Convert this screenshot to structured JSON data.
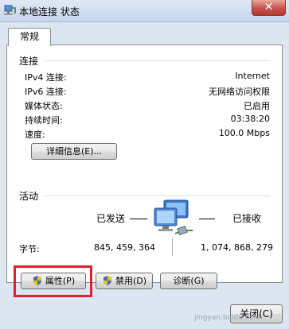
{
  "window": {
    "title": "本地连接 状态",
    "close_glyph": "✕"
  },
  "tabs": [
    {
      "label": "常规"
    }
  ],
  "connection": {
    "heading": "连接",
    "rows": [
      {
        "label": "IPv4 连接:",
        "value": "Internet"
      },
      {
        "label": "IPv6 连接:",
        "value": "无网络访问权限"
      },
      {
        "label": "媒体状态:",
        "value": "已启用"
      },
      {
        "label": "持续时间:",
        "value": "03:38:20"
      },
      {
        "label": "速度:",
        "value": "100.0 Mbps"
      }
    ],
    "details_button": "详细信息(E)..."
  },
  "activity": {
    "heading": "活动",
    "sent_label": "已发送",
    "received_label": "已接收",
    "bytes_label": "字节:",
    "bytes_sent": "845, 459, 364",
    "bytes_received": "1, 074, 868, 279"
  },
  "actions": {
    "properties": "属性(P)",
    "disable": "禁用(D)",
    "diagnose": "诊断(G)"
  },
  "footer": {
    "close_button": "关闭(C)",
    "watermark": "jingyan.baidu.com"
  },
  "colors": {
    "highlight": "#d9232e",
    "titlebar": "#c6d6ec",
    "close": "#c75050"
  },
  "icons": {
    "window": "network-icon",
    "shield": "uac-shield-icon",
    "activity": "network-computers-icon"
  }
}
